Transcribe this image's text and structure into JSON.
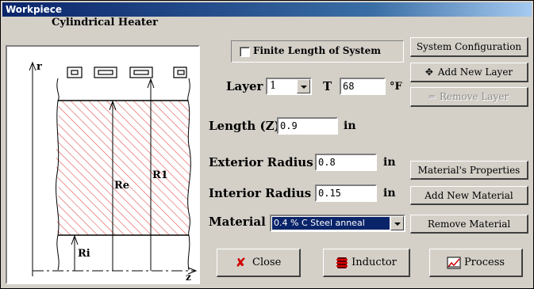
{
  "window": {
    "title": "Workpiece"
  },
  "diagram": {
    "title": "Cylindrical Heater",
    "axis_r": "r",
    "axis_z": "z",
    "label_re": "Re",
    "label_r1": "R1",
    "label_ri": "Ri",
    "hatch_color": "#e05050"
  },
  "finite_length": {
    "label": "Finite Length of System",
    "checked": false
  },
  "layer": {
    "label": "Layer",
    "value": "1"
  },
  "temperature": {
    "label": "T",
    "value": "68",
    "unit": "°F"
  },
  "length": {
    "label": "Length (Z)",
    "value": "0.9",
    "unit": "in"
  },
  "exterior_radius": {
    "label": "Exterior Radius",
    "value": "0.8",
    "unit": "in"
  },
  "interior_radius": {
    "label": "Interior Radius",
    "value": "0.15",
    "unit": "in"
  },
  "material": {
    "label": "Material",
    "value": "0.4 % C Steel anneal"
  },
  "buttons": {
    "system_configuration": "System Configuration",
    "add_new_layer": "Add New Layer",
    "remove_layer": "Remove Layer",
    "material_properties": "Material's Properties",
    "add_new_material": "Add New Material",
    "remove_material": "Remove Material",
    "close": "Close",
    "inductor": "Inductor",
    "process": "Process"
  }
}
